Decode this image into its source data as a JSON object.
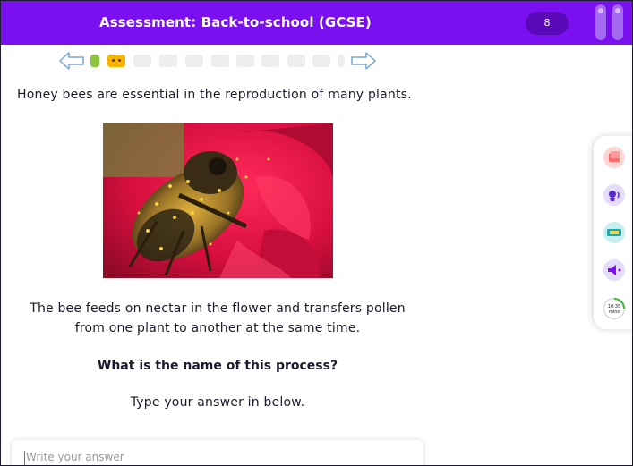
{
  "header": {
    "title": "Assessment: Back-to-school (GCSE)",
    "score": "8"
  },
  "question": {
    "intro": "Honey bees are essential in the reproduction of many plants.",
    "paragraph_line1": "The bee feeds on nectar in the flower and transfers pollen",
    "paragraph_line2": "from one plant to another at the same time.",
    "prompt": "What is the name of this process?",
    "instruction": "Type your answer in below."
  },
  "answer": {
    "placeholder": "Write your answer",
    "value": ""
  },
  "progress": {
    "current": 2,
    "total": 11
  },
  "side_tools": {
    "timer_time": "10:35",
    "timer_unit": "mins",
    "icons": [
      "flashcards-icon",
      "voice-icon",
      "translate-icon",
      "audio-icon",
      "timer-icon"
    ]
  },
  "colors": {
    "brand": "#7a0ff0",
    "answered": "#8cc63f",
    "current": "#f7b500"
  }
}
